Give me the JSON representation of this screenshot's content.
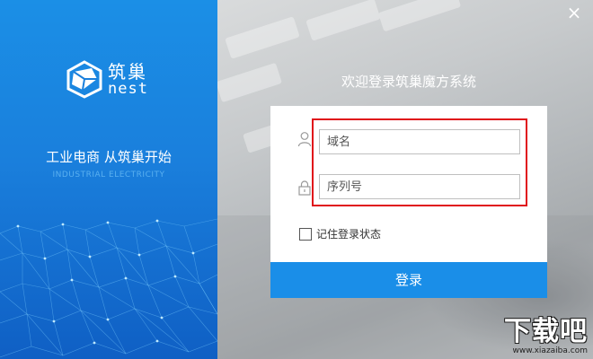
{
  "brand": {
    "name_cn": "筑巢",
    "name_en": "nest"
  },
  "slogan": {
    "cn": "工业电商 从筑巢开始",
    "en": "INDUSTRIAL ELECTRICITY"
  },
  "window": {
    "close_glyph": "×"
  },
  "form": {
    "welcome": "欢迎登录筑巢魔方系统",
    "domain_placeholder": "域名",
    "serial_placeholder": "序列号",
    "remember_label": "记住登录状态",
    "remember_checked": false,
    "login_label": "登录"
  },
  "watermark": {
    "big": "下载吧",
    "small": "www.xiazaiba.com"
  },
  "icons": {
    "user": "user-icon",
    "lock": "lock-icon",
    "logo": "cube-logo-icon",
    "close": "close-icon"
  },
  "colors": {
    "panel_blue": "#1a7fdc",
    "button_blue": "#1a8ee8",
    "highlight_red": "#e0101a"
  }
}
